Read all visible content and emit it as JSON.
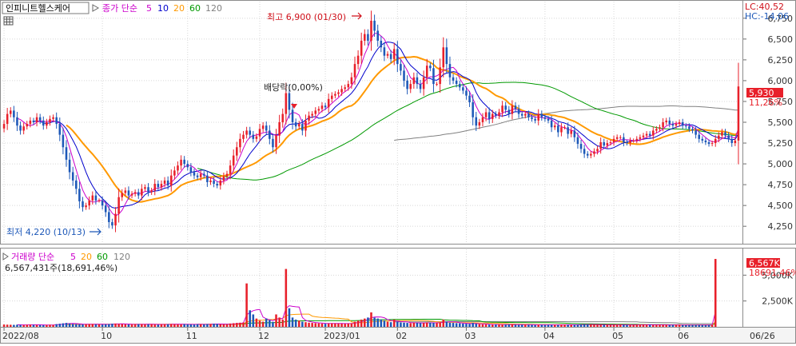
{
  "stock": {
    "name": "인피니트헬스케어",
    "ma_label": "종가 단순",
    "ma_periods": [
      "5",
      "10",
      "20",
      "60",
      "120"
    ],
    "ma_colors": [
      "#cc00cc",
      "#0000cc",
      "#ff9900",
      "#009900",
      "#808080"
    ]
  },
  "volume": {
    "title": "거래량 단순",
    "ma_periods": [
      "5",
      "20",
      "60",
      "120"
    ],
    "ma_colors": [
      "#cc00cc",
      "#ff9900",
      "#009900",
      "#808080"
    ],
    "summary": "6,567,431주(18,691,46%)"
  },
  "indicators": {
    "lc": "LC:40,52",
    "hc": "HC:-14,06"
  },
  "price_tag": {
    "value": "5,930",
    "change": "11,26%"
  },
  "volume_tag": {
    "value": "6,567K",
    "change": "18691,46%"
  },
  "annotations": {
    "high": "최고 6,900 (01/30)",
    "low": "최저 4,220 (10/13)",
    "dividend": "배당락(0,00%)"
  },
  "colors": {
    "up": "#e8202a",
    "down": "#1d58b8",
    "axis": "#6e6e6e",
    "grid": "#d8d8d8"
  },
  "chart_data": {
    "type": "candlestick",
    "price_axis": {
      "ylim": [
        4050,
        6950
      ],
      "ticks": [
        "4,250",
        "4,500",
        "4,750",
        "5,000",
        "5,250",
        "5,500",
        "5,750",
        "6,000",
        "6,250",
        "6,500",
        "6,750"
      ],
      "tick_values": [
        4250,
        4500,
        4750,
        5000,
        5250,
        5500,
        5750,
        6000,
        6250,
        6500,
        6750
      ]
    },
    "volume_axis": {
      "ylim": [
        0,
        7500000
      ],
      "ticks": [
        "2,500K",
        "5,000K"
      ],
      "tick_values": [
        2500000,
        5000000
      ]
    },
    "x_labels": [
      "2022/08",
      "10",
      "11",
      "12",
      "2023/01",
      "02",
      "03",
      "04",
      "05",
      "06",
      "06/26"
    ],
    "x_label_index": [
      0,
      30,
      56,
      78,
      98,
      120,
      141,
      165,
      186,
      206,
      239
    ],
    "closes": [
      5480,
      5600,
      5640,
      5560,
      5460,
      5400,
      5450,
      5480,
      5520,
      5500,
      5560,
      5520,
      5460,
      5500,
      5540,
      5560,
      5480,
      5350,
      5200,
      5050,
      4900,
      4800,
      4700,
      4550,
      4480,
      4500,
      4560,
      4620,
      4560,
      4560,
      4500,
      4420,
      4300,
      4260,
      4400,
      4600,
      4650,
      4680,
      4620,
      4640,
      4660,
      4620,
      4700,
      4720,
      4660,
      4680,
      4760,
      4720,
      4760,
      4800,
      4740,
      4860,
      4920,
      4980,
      5050,
      5000,
      4960,
      4900,
      4860,
      4840,
      4880,
      4860,
      4780,
      4800,
      4760,
      4740,
      4800,
      4850,
      4880,
      4980,
      5100,
      5200,
      5300,
      5350,
      5400,
      5350,
      5300,
      5330,
      5420,
      5460,
      5400,
      5300,
      5200,
      5340,
      5500,
      5600,
      5850,
      5650,
      5500,
      5450,
      5480,
      5400,
      5520,
      5580,
      5600,
      5640,
      5660,
      5700,
      5680,
      5780,
      5820,
      5840,
      5860,
      5900,
      5920,
      5960,
      6040,
      6200,
      6300,
      6480,
      6560,
      6480,
      6720,
      6600,
      6480,
      6400,
      6300,
      6320,
      6260,
      6380,
      6200,
      6120,
      6000,
      5900,
      5960,
      6040,
      5960,
      5900,
      6040,
      6180,
      6150,
      5960,
      5960,
      6160,
      6400,
      6200,
      6040,
      6000,
      5960,
      5920,
      5880,
      5820,
      5740,
      5560,
      5460,
      5500,
      5560,
      5620,
      5540,
      5600,
      5580,
      5620,
      5700,
      5650,
      5600,
      5700,
      5660,
      5600,
      5580,
      5600,
      5560,
      5540,
      5520,
      5600,
      5560,
      5540,
      5520,
      5440,
      5460,
      5380,
      5440,
      5440,
      5360,
      5400,
      5320,
      5240,
      5180,
      5120,
      5100,
      5120,
      5150,
      5180,
      5260,
      5220,
      5250,
      5260,
      5300,
      5320,
      5320,
      5260,
      5250,
      5280,
      5280,
      5300,
      5320,
      5340,
      5360,
      5340,
      5400,
      5420,
      5440,
      5500,
      5520,
      5480,
      5460,
      5480,
      5500,
      5460,
      5450,
      5420,
      5400,
      5350,
      5300,
      5280,
      5260,
      5240,
      5250,
      5300,
      5340,
      5380,
      5340,
      5300,
      5250,
      5280,
      5930
    ],
    "volumes": [
      220000,
      210000,
      200000,
      190000,
      200000,
      180000,
      170000,
      200000,
      210000,
      190000,
      180000,
      170000,
      160000,
      180000,
      200000,
      190000,
      260000,
      300000,
      340000,
      380000,
      320000,
      280000,
      260000,
      240000,
      230000,
      250000,
      260000,
      270000,
      240000,
      230000,
      220000,
      240000,
      260000,
      300000,
      320000,
      280000,
      260000,
      240000,
      230000,
      220000,
      250000,
      260000,
      240000,
      230000,
      250000,
      240000,
      220000,
      210000,
      230000,
      250000,
      260000,
      270000,
      240000,
      230000,
      220000,
      260000,
      240000,
      230000,
      220000,
      250000,
      240000,
      230000,
      260000,
      270000,
      300000,
      280000,
      240000,
      230000,
      220000,
      320000,
      350000,
      380000,
      400000,
      420000,
      4200000,
      1600000,
      1200000,
      800000,
      600000,
      500000,
      800000,
      650000,
      480000,
      1200000,
      900000,
      700000,
      5600000,
      1800000,
      900000,
      700000,
      600000,
      500000,
      450000,
      400000,
      380000,
      360000,
      340000,
      320000,
      300000,
      320000,
      340000,
      330000,
      320000,
      310000,
      300000,
      320000,
      350000,
      500000,
      600000,
      700000,
      800000,
      900000,
      1400000,
      900000,
      800000,
      700000,
      600000,
      500000,
      450000,
      700000,
      500000,
      420000,
      400000,
      380000,
      360000,
      400000,
      380000,
      360000,
      380000,
      420000,
      400000,
      380000,
      360000,
      420000,
      700000,
      500000,
      400000,
      380000,
      360000,
      340000,
      320000,
      300000,
      280000,
      380000,
      300000,
      260000,
      240000,
      230000,
      220000,
      210000,
      220000,
      230000,
      220000,
      210000,
      220000,
      210000,
      200000,
      190000,
      200000,
      210000,
      200000,
      190000,
      180000,
      200000,
      190000,
      180000,
      200000,
      190000,
      180000,
      190000,
      200000,
      210000,
      200000,
      190000,
      180000,
      200000,
      220000,
      240000,
      230000,
      220000,
      210000,
      200000,
      190000,
      180000,
      200000,
      190000,
      180000,
      190000,
      200000,
      190000,
      180000,
      170000,
      180000,
      190000,
      200000,
      210000,
      200000,
      190000,
      180000,
      190000,
      200000,
      190000,
      180000,
      170000,
      180000,
      190000,
      180000,
      170000,
      160000,
      170000,
      180000,
      190000,
      180000,
      170000,
      160000,
      170000,
      180000,
      6567431
    ]
  }
}
